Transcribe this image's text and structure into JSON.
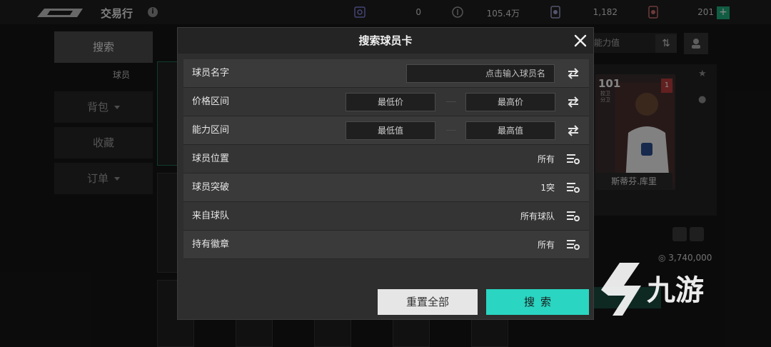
{
  "topbar": {
    "title": "交易行",
    "currencies": [
      {
        "icon": "ticket-icon",
        "value": "0"
      },
      {
        "icon": "coin-icon",
        "value": "105.4万"
      },
      {
        "icon": "token-icon",
        "value": "1,182"
      },
      {
        "icon": "gem-icon",
        "value": "201"
      }
    ],
    "add_symbol": "+"
  },
  "sidebar": {
    "items": [
      {
        "label": "搜索",
        "active": true
      },
      {
        "label": "背包",
        "dropdown": true
      },
      {
        "label": "收藏"
      },
      {
        "label": "订单",
        "dropdown": true
      }
    ],
    "sub_item": "球员"
  },
  "background": {
    "sort_field": "能力值",
    "featured_card": {
      "rating": "101",
      "pos_line1": "控卫",
      "pos_line2": "分卫",
      "badge": "1",
      "name": "斯蒂芬.库里"
    },
    "price": "3,740,000"
  },
  "modal": {
    "title": "搜索球员卡",
    "rows": [
      {
        "label": "球员名字",
        "kind": "text",
        "placeholder": "点击输入球员名"
      },
      {
        "label": "价格区间",
        "kind": "range",
        "min": "最低价",
        "max": "最高价"
      },
      {
        "label": "能力区间",
        "kind": "range",
        "min": "最低值",
        "max": "最高值"
      },
      {
        "label": "球员位置",
        "kind": "filter",
        "value": "所有"
      },
      {
        "label": "球员突破",
        "kind": "filter",
        "value": "1突"
      },
      {
        "label": "来自球队",
        "kind": "filter",
        "value": "所有球队"
      },
      {
        "label": "持有徽章",
        "kind": "filter",
        "value": "所有"
      }
    ],
    "reset_label": "重置全部",
    "search_label": "搜索"
  },
  "watermark": {
    "text": "九游"
  },
  "colors": {
    "accent": "#2ad5c1",
    "green": "#1fa97a",
    "red": "#b23b3b"
  }
}
